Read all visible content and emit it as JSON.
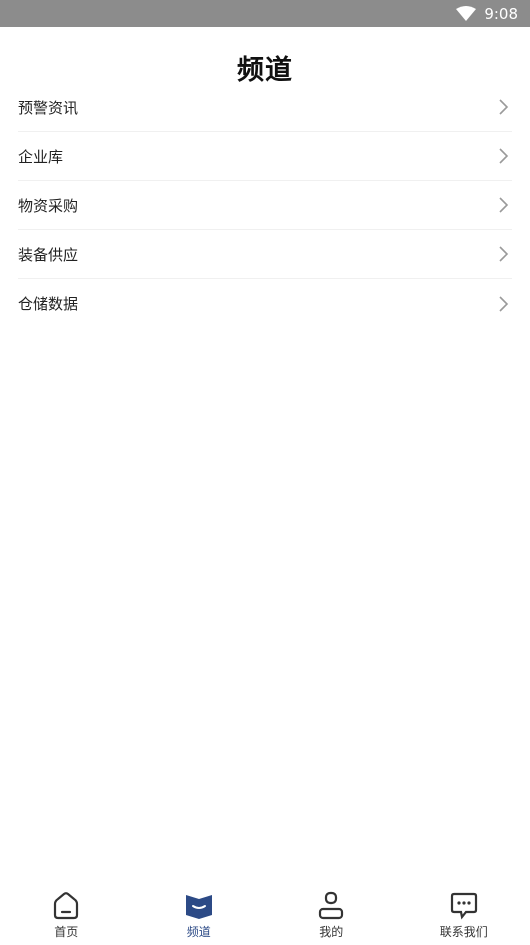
{
  "status_bar": {
    "time": "9:08",
    "wifi_icon": "wifi-icon"
  },
  "header": {
    "title": "频道"
  },
  "menu": {
    "items": [
      {
        "label": "预警资讯",
        "icon": "chevron-right-icon"
      },
      {
        "label": "企业库",
        "icon": "chevron-right-icon"
      },
      {
        "label": "物资采购",
        "icon": "chevron-right-icon"
      },
      {
        "label": "装备供应",
        "icon": "chevron-right-icon"
      },
      {
        "label": "仓储数据",
        "icon": "chevron-right-icon"
      }
    ]
  },
  "tab_bar": {
    "active_color": "#2c4a86",
    "tabs": [
      {
        "label": "首页",
        "icon": "home-icon",
        "active": false
      },
      {
        "label": "频道",
        "icon": "book-icon",
        "active": true
      },
      {
        "label": "我的",
        "icon": "user-icon",
        "active": false
      },
      {
        "label": "联系我们",
        "icon": "chat-icon",
        "active": false
      }
    ]
  }
}
